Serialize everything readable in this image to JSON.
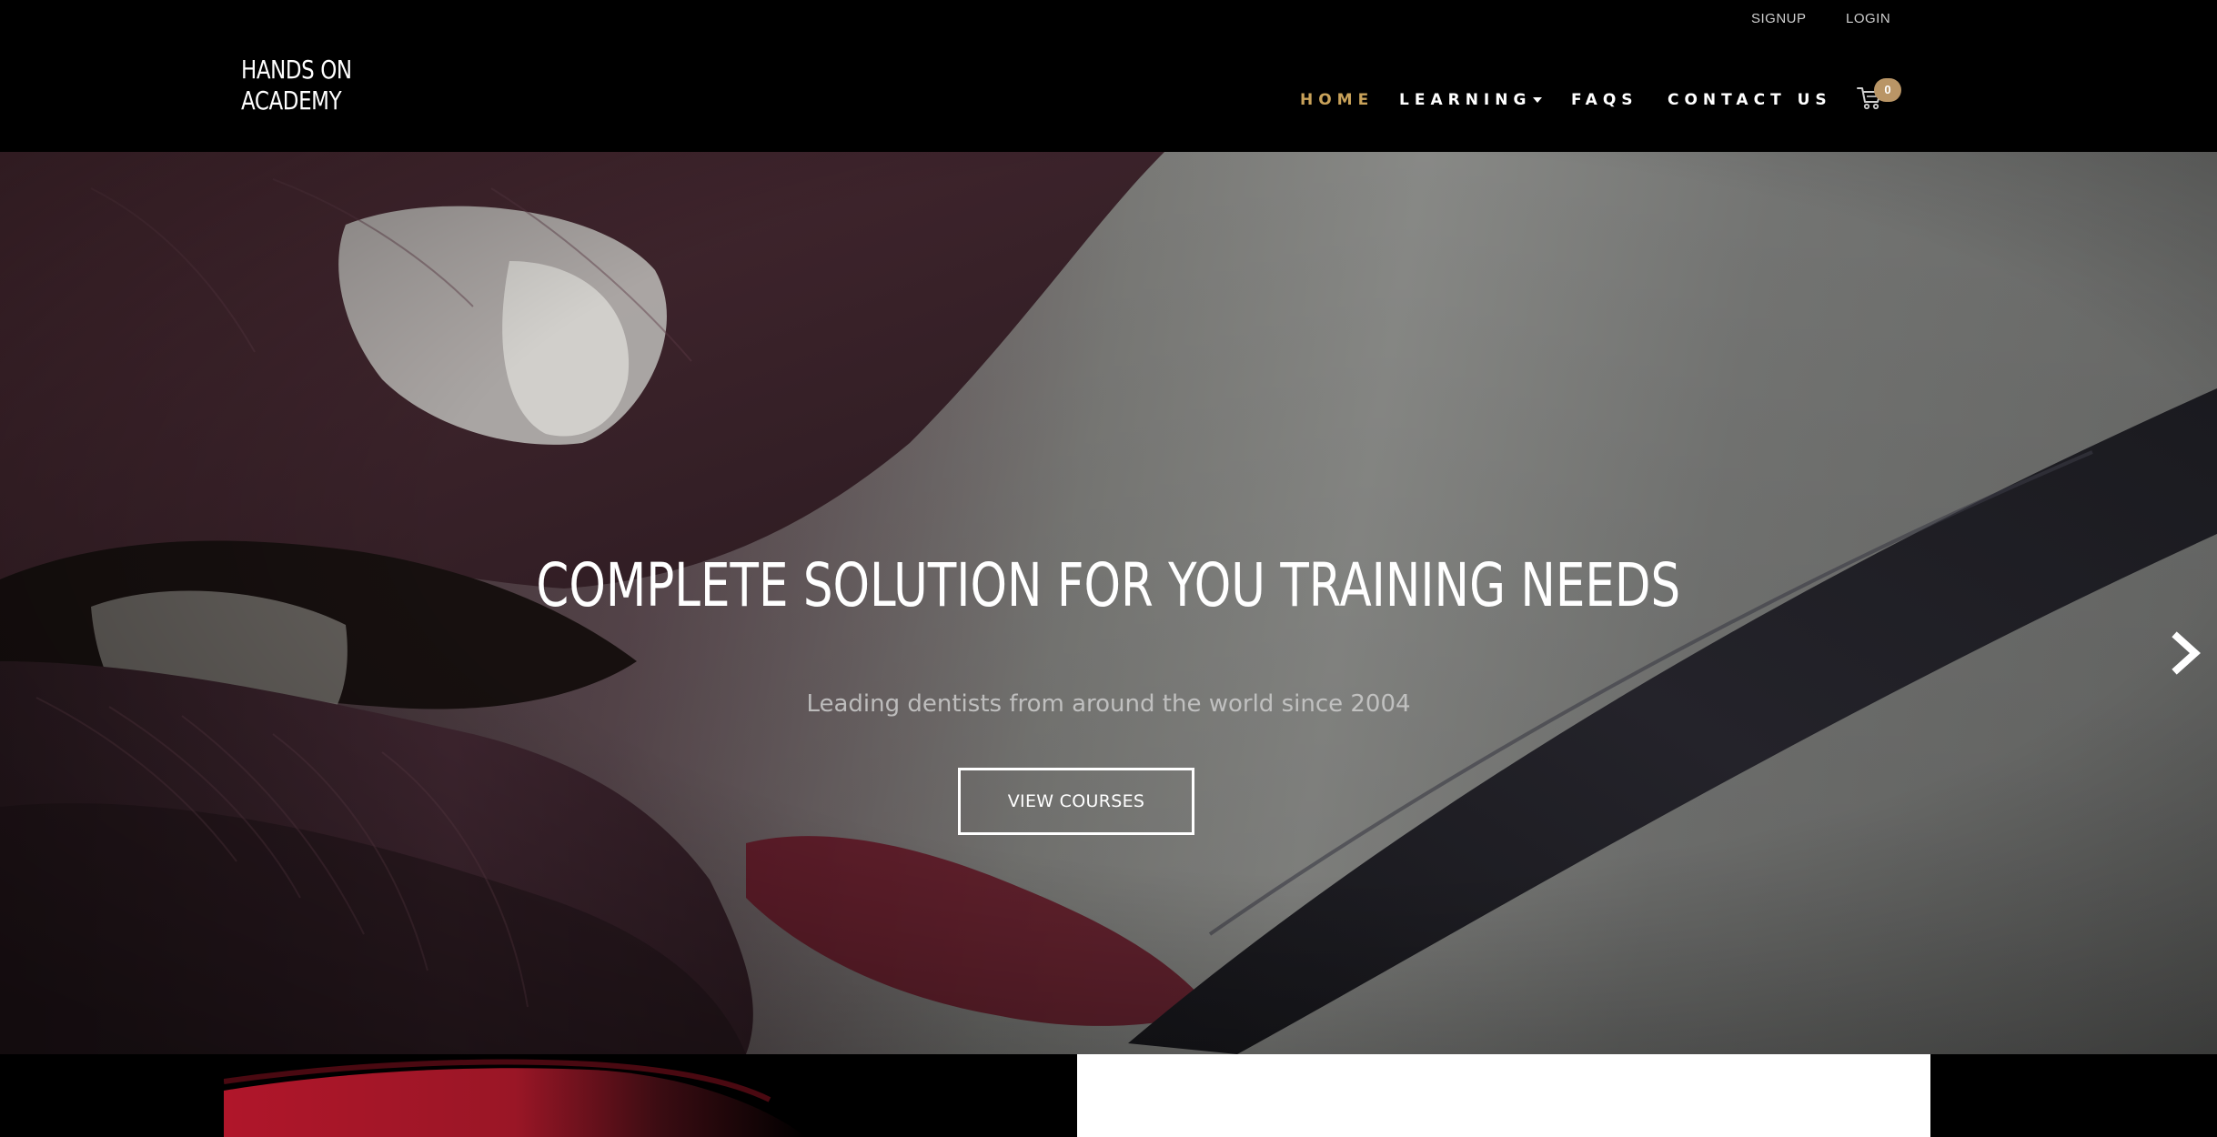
{
  "header": {
    "utility_links": {
      "signup": "SIGNUP",
      "login": "LOGIN"
    },
    "logo": {
      "line1": "HANDS ON",
      "line2": "ACADEMY"
    },
    "nav": {
      "home": "HOME",
      "learning": "LEARNING",
      "faqs": "FAQS",
      "contact": "CONTACT US"
    },
    "cart": {
      "count": "0",
      "icon": "shopping-cart-icon"
    }
  },
  "hero": {
    "title": "COMPLETE SOLUTION FOR YOU TRAINING NEEDS",
    "subtitle": "Leading dentists from around the world since 2004",
    "button_label": "VIEW COURSES",
    "next_icon": "chevron-right-icon"
  },
  "colors": {
    "accent": "#c9a25a",
    "badge": "#b99566",
    "header_bg": "#000000"
  }
}
